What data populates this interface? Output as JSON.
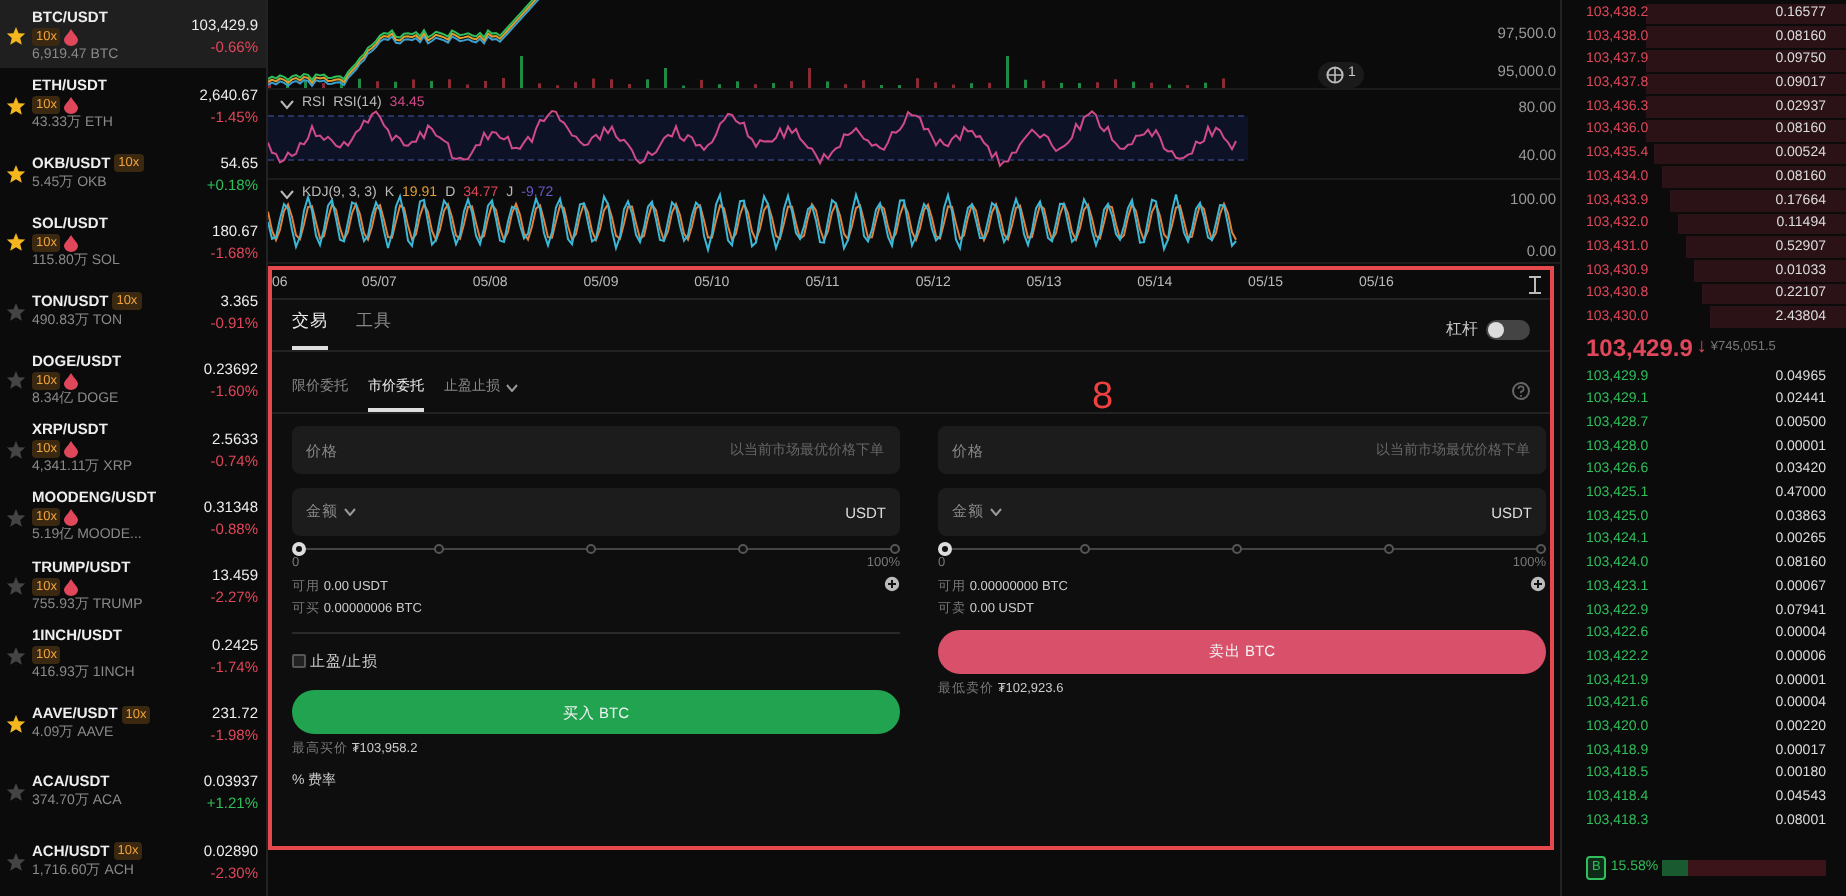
{
  "sidebar": {
    "markets": [
      {
        "pair": "BTC/USDT",
        "badge": "10x",
        "badge_inline": false,
        "drop": true,
        "volume": "6,919.47 BTC",
        "price": "103,429.9",
        "change": "-0.66%",
        "rising": false,
        "starred": true,
        "selected": true
      },
      {
        "pair": "ETH/USDT",
        "badge": "10x",
        "badge_inline": false,
        "drop": true,
        "volume": "43.33万 ETH",
        "price": "2,640.67",
        "change": "-1.45%",
        "rising": false,
        "starred": true,
        "selected": false
      },
      {
        "pair": "OKB/USDT",
        "badge": "10x",
        "badge_inline": true,
        "drop": false,
        "volume": "5.45万 OKB",
        "price": "54.65",
        "change": "+0.18%",
        "rising": true,
        "starred": true,
        "selected": false
      },
      {
        "pair": "SOL/USDT",
        "badge": "10x",
        "badge_inline": false,
        "drop": true,
        "volume": "115.80万 SOL",
        "price": "180.67",
        "change": "-1.68%",
        "rising": false,
        "starred": true,
        "selected": false
      },
      {
        "pair": "TON/USDT",
        "badge": "10x",
        "badge_inline": true,
        "drop": false,
        "volume": "490.83万 TON",
        "price": "3.365",
        "change": "-0.91%",
        "rising": false,
        "starred": false,
        "selected": false
      },
      {
        "pair": "DOGE/USDT",
        "badge": "10x",
        "badge_inline": false,
        "drop": true,
        "volume": "8.34亿 DOGE",
        "price": "0.23692",
        "change": "-1.60%",
        "rising": false,
        "starred": false,
        "selected": false
      },
      {
        "pair": "XRP/USDT",
        "badge": "10x",
        "badge_inline": false,
        "drop": true,
        "volume": "4,341.11万 XRP",
        "price": "2.5633",
        "change": "-0.74%",
        "rising": false,
        "starred": false,
        "selected": false
      },
      {
        "pair": "MOODENG/USDT",
        "badge": "10x",
        "badge_inline": false,
        "drop": true,
        "volume": "5.19亿 MOODE...",
        "price": "0.31348",
        "change": "-0.88%",
        "rising": false,
        "starred": false,
        "selected": false
      },
      {
        "pair": "TRUMP/USDT",
        "badge": "10x",
        "badge_inline": false,
        "drop": true,
        "volume": "755.93万 TRUMP",
        "price": "13.459",
        "change": "-2.27%",
        "rising": false,
        "starred": false,
        "selected": false
      },
      {
        "pair": "1INCH/USDT",
        "badge": "10x",
        "badge_inline": false,
        "drop": false,
        "volume": "416.93万 1INCH",
        "price": "0.2425",
        "change": "-1.74%",
        "rising": false,
        "starred": false,
        "selected": false
      },
      {
        "pair": "AAVE/USDT",
        "badge": "10x",
        "badge_inline": true,
        "drop": false,
        "volume": "4.09万 AAVE",
        "price": "231.72",
        "change": "-1.98%",
        "rising": false,
        "starred": true,
        "selected": false
      },
      {
        "pair": "ACA/USDT",
        "volume": "374.70万 ACA",
        "price": "0.03937",
        "change": "+1.21%",
        "rising": true,
        "starred": false,
        "selected": false
      },
      {
        "pair": "ACH/USDT",
        "badge": "10x",
        "badge_inline": true,
        "drop": false,
        "volume": "1,716.60万 ACH",
        "price": "0.02890",
        "change": "-2.30%",
        "rising": false,
        "starred": false,
        "selected": false
      }
    ]
  },
  "chart": {
    "price_axis": [
      "97,500.0",
      "95,000.0"
    ],
    "marker_count": "1",
    "rsi": {
      "label": "RSI",
      "setting": "RSI(14)",
      "value": "34.45",
      "axis": [
        "80.00",
        "40.00"
      ]
    },
    "kdj": {
      "setting": "KDJ(9, 3, 3)",
      "readings": [
        {
          "name": "K",
          "value": "19.91",
          "color": "#e0a030"
        },
        {
          "name": "D",
          "value": "34.77",
          "color": "#e0475a"
        },
        {
          "name": "J",
          "value": "-9.72",
          "color": "#6a5acd"
        }
      ],
      "axis": [
        "100.00",
        "0.00"
      ]
    },
    "dates": [
      "06",
      "05/07",
      "05/08",
      "05/09",
      "05/10",
      "05/11",
      "05/12",
      "05/13",
      "05/14",
      "05/15",
      "05/16"
    ]
  },
  "trade": {
    "tabs": [
      {
        "label": "交易",
        "selected": true
      },
      {
        "label": "工具",
        "selected": false
      }
    ],
    "leverage": {
      "label": "杠杆",
      "on": false
    },
    "order_types": [
      {
        "label": "限价委托",
        "selected": false,
        "dropdown": false
      },
      {
        "label": "市价委托",
        "selected": true,
        "dropdown": false
      },
      {
        "label": "止盈止损",
        "selected": false,
        "dropdown": true
      }
    ],
    "sides": [
      {
        "kind": "buy",
        "price_label": "价格",
        "price_placeholder": "以当前市场最优价格下单",
        "amount_label": "金额",
        "unit": "USDT",
        "slider": {
          "level": 0,
          "min_label": "0",
          "max_label": "100%"
        },
        "balances": [
          {
            "label": "可用",
            "value": "0.00 USDT"
          },
          {
            "label": "可买",
            "value": "0.00000006 BTC"
          }
        ],
        "tp_sl": {
          "label": "止盈/止损",
          "checked": false
        },
        "button": "买入 BTC",
        "limit_label": "最高买价",
        "limit_value": "₮103,958.2",
        "fee": {
          "icon": "%",
          "label": "费率"
        }
      },
      {
        "kind": "sell",
        "price_label": "价格",
        "price_placeholder": "以当前市场最优价格下单",
        "amount_label": "金额",
        "unit": "USDT",
        "slider": {
          "level": 0,
          "min_label": "0",
          "max_label": "100%"
        },
        "balances": [
          {
            "label": "可用",
            "value": "0.00000000 BTC"
          },
          {
            "label": "可卖",
            "value": "0.00 USDT"
          }
        ],
        "button": "卖出 BTC",
        "limit_label": "最低卖价",
        "limit_value": "₮102,923.6"
      }
    ]
  },
  "order_book": {
    "asks": [
      {
        "price": "103,438.2",
        "size": "0.16577"
      },
      {
        "price": "103,438.0",
        "size": "0.08160"
      },
      {
        "price": "103,437.9",
        "size": "0.09750"
      },
      {
        "price": "103,437.8",
        "size": "0.09017"
      },
      {
        "price": "103,436.3",
        "size": "0.02937"
      },
      {
        "price": "103,436.0",
        "size": "0.08160"
      },
      {
        "price": "103,435.4",
        "size": "0.00524"
      },
      {
        "price": "103,434.0",
        "size": "0.08160"
      },
      {
        "price": "103,433.9",
        "size": "0.17664"
      },
      {
        "price": "103,432.0",
        "size": "0.11494"
      },
      {
        "price": "103,431.0",
        "size": "0.52907"
      },
      {
        "price": "103,430.9",
        "size": "0.01033"
      },
      {
        "price": "103,430.8",
        "size": "0.22107"
      },
      {
        "price": "103,430.0",
        "size": "2.43804"
      }
    ],
    "last": {
      "price": "103,429.9",
      "arrow": "↓",
      "fiat": "¥745,051.5"
    },
    "bids": [
      {
        "price": "103,429.9",
        "size": "0.04965"
      },
      {
        "price": "103,429.1",
        "size": "0.02441"
      },
      {
        "price": "103,428.7",
        "size": "0.00500"
      },
      {
        "price": "103,428.0",
        "size": "0.00001"
      },
      {
        "price": "103,426.6",
        "size": "0.03420"
      },
      {
        "price": "103,425.1",
        "size": "0.47000"
      },
      {
        "price": "103,425.0",
        "size": "0.03863"
      },
      {
        "price": "103,424.1",
        "size": "0.00265"
      },
      {
        "price": "103,424.0",
        "size": "0.08160"
      },
      {
        "price": "103,423.1",
        "size": "0.00067"
      },
      {
        "price": "103,422.9",
        "size": "0.07941"
      },
      {
        "price": "103,422.6",
        "size": "0.00004"
      },
      {
        "price": "103,422.2",
        "size": "0.00006"
      },
      {
        "price": "103,421.9",
        "size": "0.00001"
      },
      {
        "price": "103,421.6",
        "size": "0.00004"
      },
      {
        "price": "103,420.0",
        "size": "0.00220"
      },
      {
        "price": "103,418.9",
        "size": "0.00017"
      },
      {
        "price": "103,418.5",
        "size": "0.00180"
      },
      {
        "price": "103,418.4",
        "size": "0.04543"
      },
      {
        "price": "103,418.3",
        "size": "0.08001"
      }
    ],
    "ratio": {
      "badge": "B",
      "reading": "15.58%",
      "level": 0.16
    }
  },
  "annotation": {
    "label": "8"
  }
}
